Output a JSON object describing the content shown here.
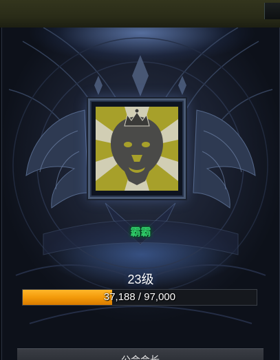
{
  "guild": {
    "name": "霸霸",
    "emblem": "lion-crown-icon",
    "level_label": "23级"
  },
  "experience": {
    "current": 37188,
    "max": 97000,
    "text": "37,188 / 97,000"
  },
  "section": {
    "label": "公会会长"
  },
  "colors": {
    "emblem_bg": "#a7a02a",
    "name_green": "#2fcf6a",
    "xp_orange": "#f39a0a"
  }
}
